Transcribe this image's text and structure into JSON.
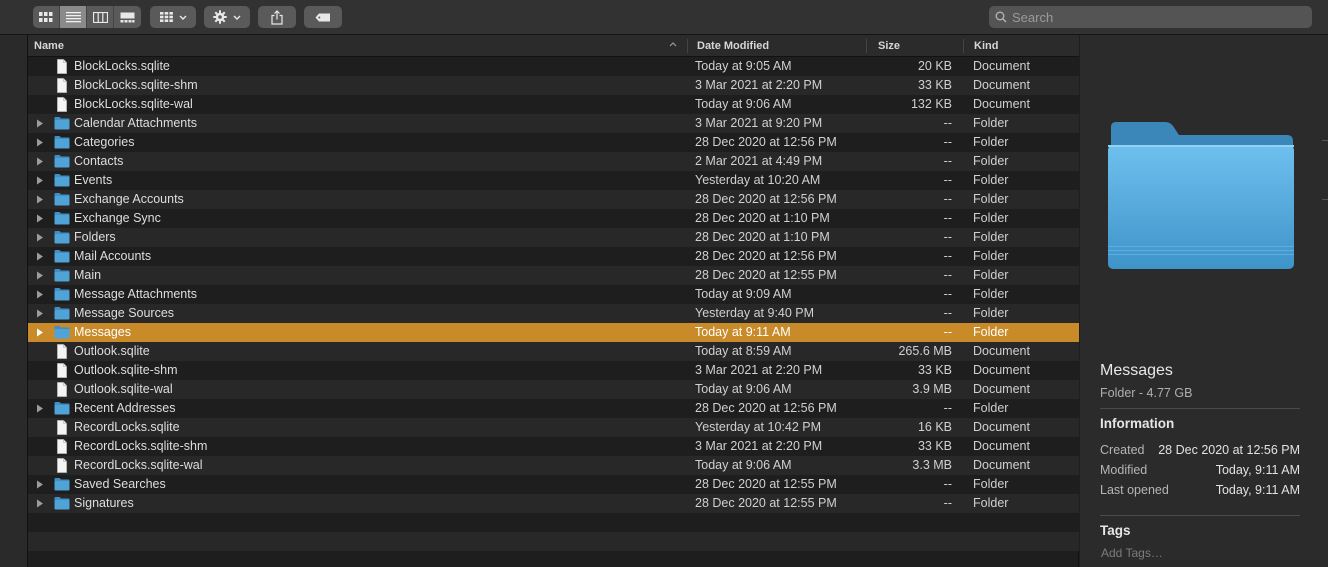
{
  "toolbar": {
    "view_buttons": [
      {
        "icon": "icon-view-icon",
        "active": false
      },
      {
        "icon": "list-view-icon",
        "active": true
      },
      {
        "icon": "column-view-icon",
        "active": false
      },
      {
        "icon": "gallery-view-icon",
        "active": false
      }
    ],
    "group_icon": "group-grid-icon",
    "action_icon": "gear-icon",
    "share_icon": "share-icon",
    "tag_icon": "tag-icon",
    "search_placeholder": "Search"
  },
  "columns": {
    "name": "Name",
    "date": "Date Modified",
    "size": "Size",
    "kind": "Kind"
  },
  "files": [
    {
      "name": "BlockLocks.sqlite",
      "date": "Today at 9:05 AM",
      "size": "20 KB",
      "kind": "Document",
      "type": "doc"
    },
    {
      "name": "BlockLocks.sqlite-shm",
      "date": "3 Mar 2021 at 2:20 PM",
      "size": "33 KB",
      "kind": "Document",
      "type": "doc"
    },
    {
      "name": "BlockLocks.sqlite-wal",
      "date": "Today at 9:06 AM",
      "size": "132 KB",
      "kind": "Document",
      "type": "doc"
    },
    {
      "name": "Calendar Attachments",
      "date": "3 Mar 2021 at 9:20 PM",
      "size": "--",
      "kind": "Folder",
      "type": "folder"
    },
    {
      "name": "Categories",
      "date": "28 Dec 2020 at 12:56 PM",
      "size": "--",
      "kind": "Folder",
      "type": "folder"
    },
    {
      "name": "Contacts",
      "date": "2 Mar 2021 at 4:49 PM",
      "size": "--",
      "kind": "Folder",
      "type": "folder"
    },
    {
      "name": "Events",
      "date": "Yesterday at 10:20 AM",
      "size": "--",
      "kind": "Folder",
      "type": "folder"
    },
    {
      "name": "Exchange Accounts",
      "date": "28 Dec 2020 at 12:56 PM",
      "size": "--",
      "kind": "Folder",
      "type": "folder"
    },
    {
      "name": "Exchange Sync",
      "date": "28 Dec 2020 at 1:10 PM",
      "size": "--",
      "kind": "Folder",
      "type": "folder"
    },
    {
      "name": "Folders",
      "date": "28 Dec 2020 at 1:10 PM",
      "size": "--",
      "kind": "Folder",
      "type": "folder"
    },
    {
      "name": "Mail Accounts",
      "date": "28 Dec 2020 at 12:56 PM",
      "size": "--",
      "kind": "Folder",
      "type": "folder"
    },
    {
      "name": "Main",
      "date": "28 Dec 2020 at 12:55 PM",
      "size": "--",
      "kind": "Folder",
      "type": "folder"
    },
    {
      "name": "Message Attachments",
      "date": "Today at 9:09 AM",
      "size": "--",
      "kind": "Folder",
      "type": "folder"
    },
    {
      "name": "Message Sources",
      "date": "Yesterday at 9:40 PM",
      "size": "--",
      "kind": "Folder",
      "type": "folder"
    },
    {
      "name": "Messages",
      "date": "Today at 9:11 AM",
      "size": "--",
      "kind": "Folder",
      "type": "folder",
      "selected": true
    },
    {
      "name": "Outlook.sqlite",
      "date": "Today at 8:59 AM",
      "size": "265.6 MB",
      "kind": "Document",
      "type": "doc"
    },
    {
      "name": "Outlook.sqlite-shm",
      "date": "3 Mar 2021 at 2:20 PM",
      "size": "33 KB",
      "kind": "Document",
      "type": "doc"
    },
    {
      "name": "Outlook.sqlite-wal",
      "date": "Today at 9:06 AM",
      "size": "3.9 MB",
      "kind": "Document",
      "type": "doc"
    },
    {
      "name": "Recent Addresses",
      "date": "28 Dec 2020 at 12:56 PM",
      "size": "--",
      "kind": "Folder",
      "type": "folder"
    },
    {
      "name": "RecordLocks.sqlite",
      "date": "Yesterday at 10:42 PM",
      "size": "16 KB",
      "kind": "Document",
      "type": "doc"
    },
    {
      "name": "RecordLocks.sqlite-shm",
      "date": "3 Mar 2021 at 2:20 PM",
      "size": "33 KB",
      "kind": "Document",
      "type": "doc"
    },
    {
      "name": "RecordLocks.sqlite-wal",
      "date": "Today at 9:06 AM",
      "size": "3.3 MB",
      "kind": "Document",
      "type": "doc"
    },
    {
      "name": "Saved Searches",
      "date": "28 Dec 2020 at 12:55 PM",
      "size": "--",
      "kind": "Folder",
      "type": "folder"
    },
    {
      "name": "Signatures",
      "date": "28 Dec 2020 at 12:55 PM",
      "size": "--",
      "kind": "Folder",
      "type": "folder"
    }
  ],
  "preview": {
    "name": "Messages",
    "subtitle": "Folder - 4.77 GB",
    "info_heading": "Information",
    "created_label": "Created",
    "created_value": "28 Dec 2020 at 12:56 PM",
    "modified_label": "Modified",
    "modified_value": "Today, 9:11 AM",
    "opened_label": "Last opened",
    "opened_value": "Today, 9:11 AM",
    "tags_heading": "Tags",
    "tags_placeholder": "Add Tags…"
  },
  "colors": {
    "selection": "#c98a2a",
    "folder": "#4fa3d6"
  }
}
